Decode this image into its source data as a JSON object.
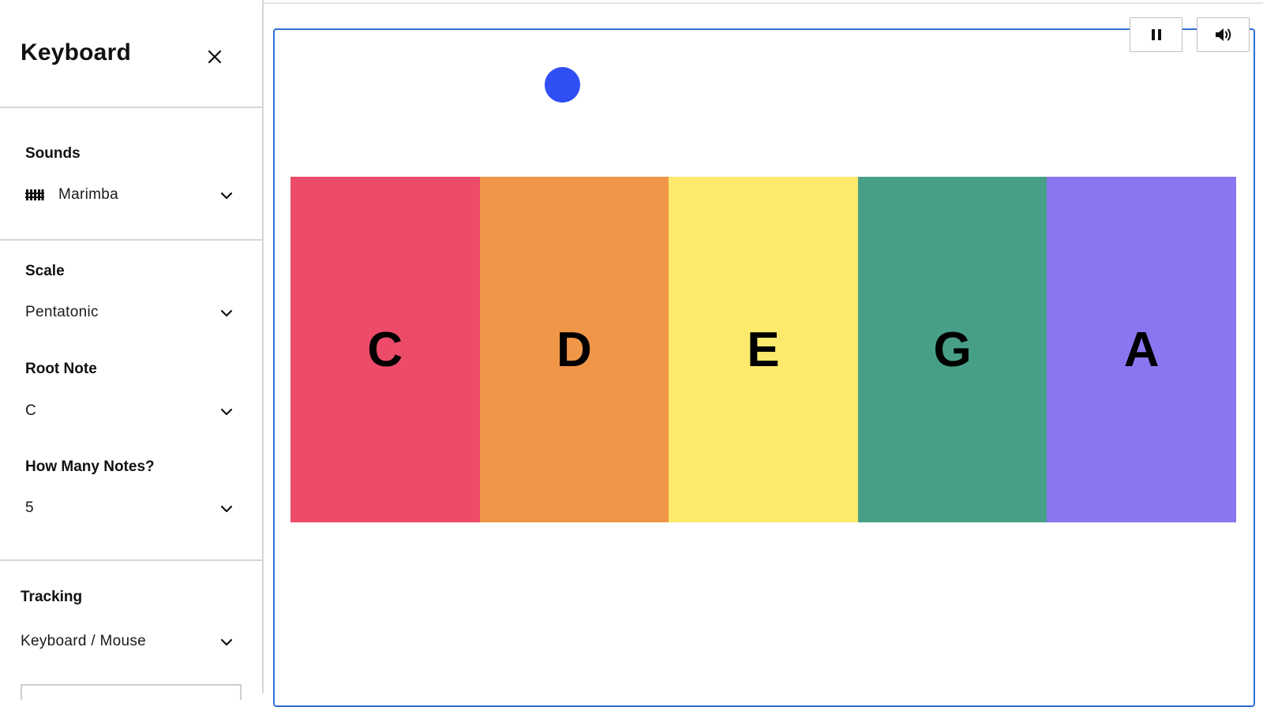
{
  "sidebar": {
    "title": "Keyboard",
    "close_icon": "close-icon",
    "sounds": {
      "label": "Sounds",
      "value": "Marimba",
      "icon": "marimba-icon"
    },
    "scale": {
      "label": "Scale",
      "value": "Pentatonic"
    },
    "root_note": {
      "label": "Root Note",
      "value": "C"
    },
    "note_count": {
      "label": "How Many Notes?",
      "value": "5"
    },
    "tracking": {
      "label": "Tracking",
      "value": "Keyboard / Mouse"
    }
  },
  "controls": {
    "pause_icon": "pause-icon",
    "volume_icon": "volume-icon"
  },
  "keys": [
    {
      "note": "C",
      "color": "#ec4c69"
    },
    {
      "note": "D",
      "color": "#f09648"
    },
    {
      "note": "E",
      "color": "#fdea6c"
    },
    {
      "note": "G",
      "color": "#489f87"
    },
    {
      "note": "A",
      "color": "#8b76f1"
    }
  ],
  "colors": {
    "cursor": "#2f4ff5",
    "stage_border": "#2f6fd6"
  }
}
